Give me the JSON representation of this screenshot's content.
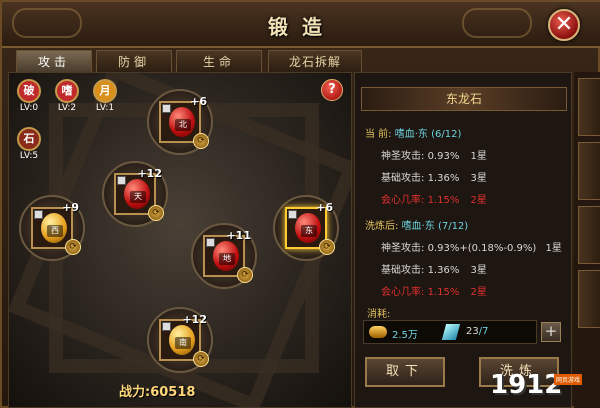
{
  "window": {
    "title": "锻造",
    "close_label": "✕"
  },
  "tabs": [
    {
      "label": "攻击",
      "active": true
    },
    {
      "label": "防御",
      "active": false
    },
    {
      "label": "生命",
      "active": false
    },
    {
      "label": "龙石拆解",
      "active": false
    }
  ],
  "mini_stones": [
    {
      "char": "破",
      "level": "LV:0",
      "color": "#c02a2a"
    },
    {
      "char": "嗜",
      "level": "LV:2",
      "color": "#c02a2a"
    },
    {
      "char": "月",
      "level": "LV:1",
      "color": "#d8901a"
    },
    {
      "char": "石",
      "level": "LV:5",
      "color": "#8a2a1a"
    }
  ],
  "help_label": "?",
  "slots": [
    {
      "level": "+6",
      "label": "北",
      "orb": "red",
      "selected": false
    },
    {
      "level": "+12",
      "label": "天",
      "orb": "red",
      "selected": false
    },
    {
      "level": "+9",
      "label": "西",
      "orb": "gold",
      "selected": false
    },
    {
      "level": "+6",
      "label": "东",
      "orb": "red",
      "selected": true
    },
    {
      "level": "+11",
      "label": "地",
      "orb": "red",
      "selected": false
    },
    {
      "level": "+12",
      "label": "南",
      "orb": "gold",
      "selected": false
    }
  ],
  "power": "战力:60518",
  "stone": {
    "name": "东龙石",
    "current_label": "当  前:",
    "current_name": "嗜血·东",
    "current_count": "(6/12)",
    "current_attrs": [
      {
        "name": "神圣攻击:",
        "value": "0.93%",
        "star": "1星",
        "color": "white"
      },
      {
        "name": "基础攻击:",
        "value": "1.36%",
        "star": "3星",
        "color": "white"
      },
      {
        "name": "会心几率:",
        "value": "1.15%",
        "star": "2星",
        "color": "red"
      }
    ],
    "after_label": "洗炼后:",
    "after_name": "嗜血·东",
    "after_count": "(7/12)",
    "after_attrs": [
      {
        "name": "神圣攻击:",
        "value": "0.93%+(0.18%-0.9%)",
        "star": "1星",
        "color": "white"
      },
      {
        "name": "基础攻击:",
        "value": "1.36%",
        "star": "3星",
        "color": "white"
      },
      {
        "name": "会心几率:",
        "value": "1.15%",
        "star": "2星",
        "color": "red"
      }
    ]
  },
  "cost": {
    "title": "消耗:",
    "gold": "2.5万",
    "gem_have": "23",
    "gem_need": "/7",
    "plus": "+"
  },
  "buttons": {
    "take_off": "取下",
    "wash": "洗炼"
  },
  "watermark": {
    "brand": "1912",
    "sub": "网页游戏"
  }
}
